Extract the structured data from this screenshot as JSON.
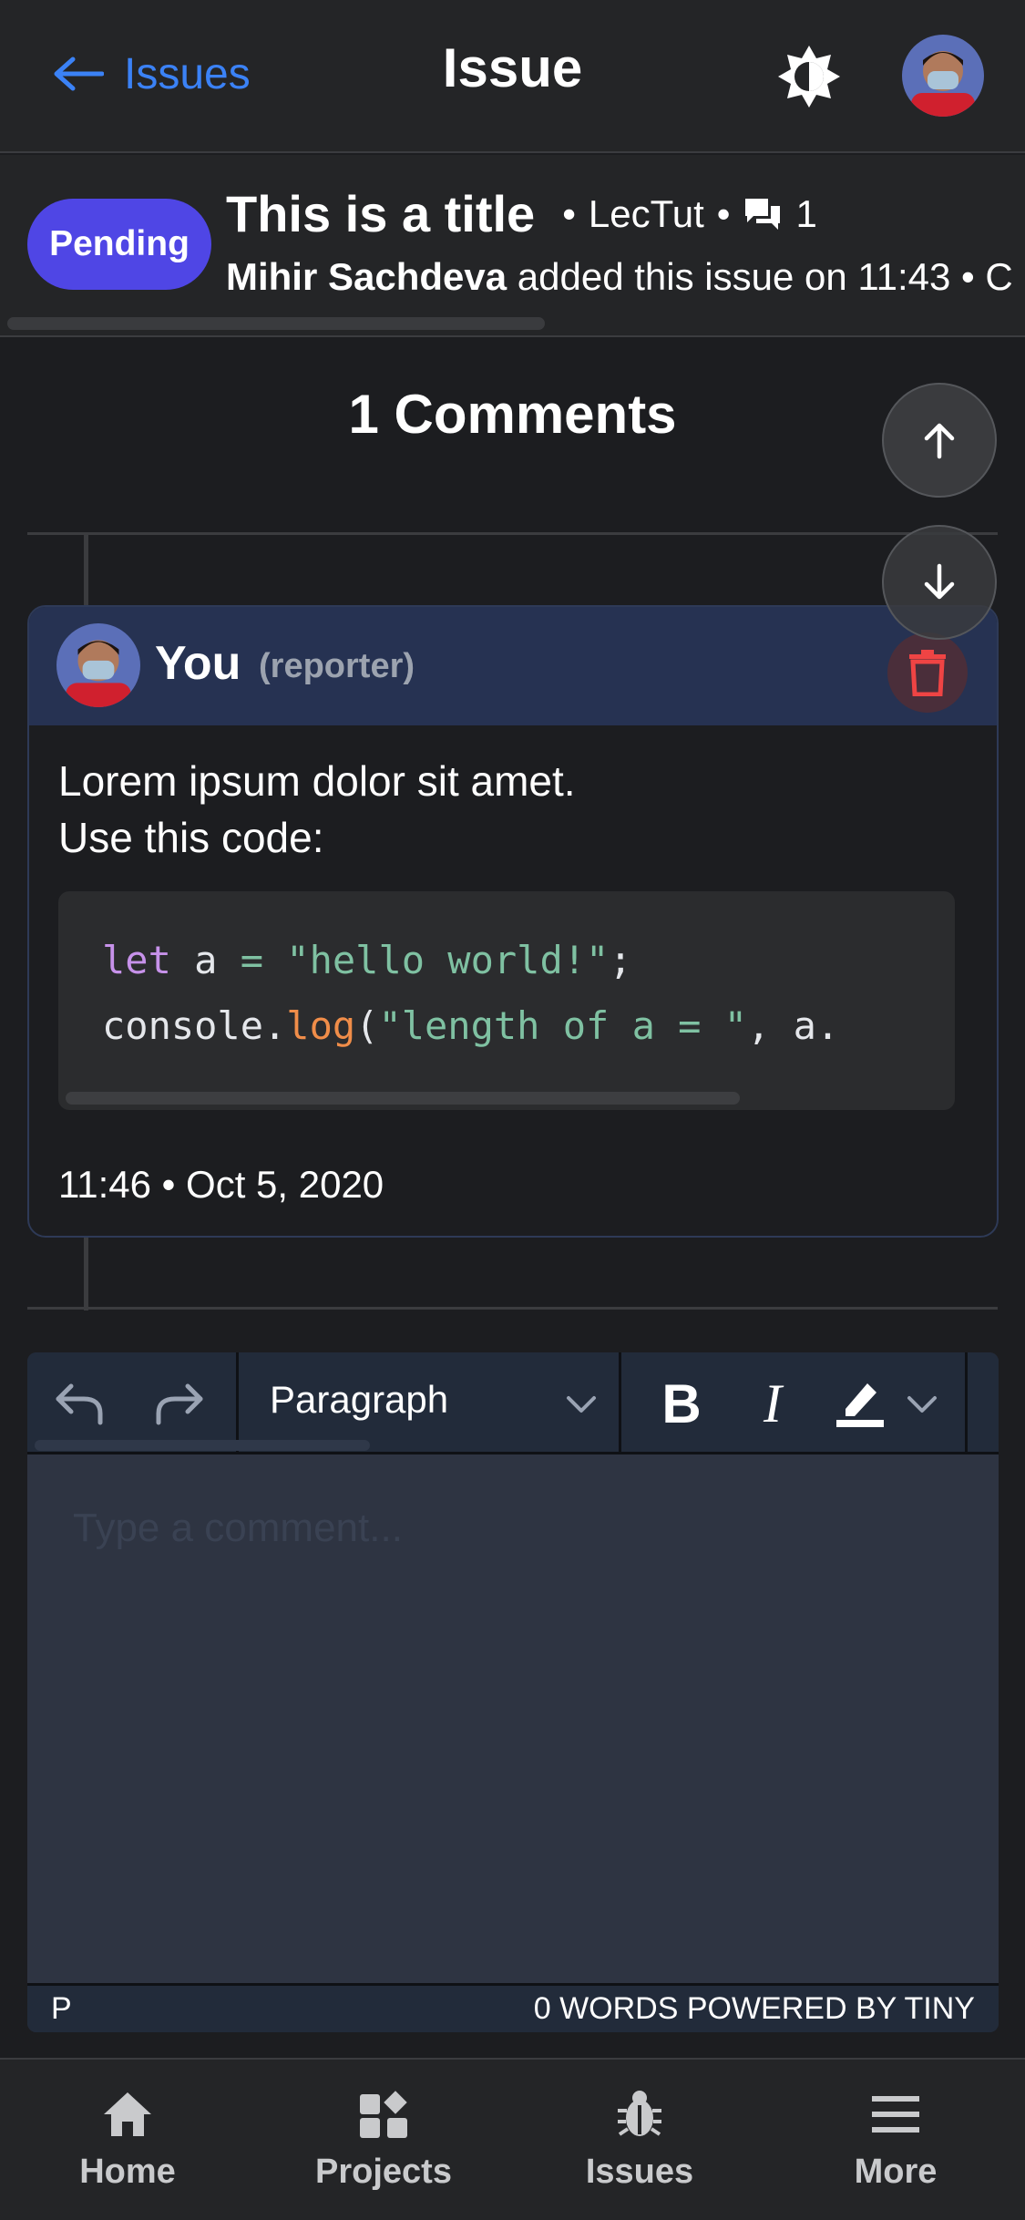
{
  "header": {
    "back_label": "Issues",
    "title": "Issue"
  },
  "issue": {
    "status": "Pending",
    "title": "This is a title",
    "project": "LecTut",
    "comment_count": "1",
    "author": "Mihir Sachdeva",
    "meta": "added this issue on 11:43 • C"
  },
  "comments": {
    "heading": "1 Comments",
    "items": [
      {
        "author": "You",
        "role": "(reporter)",
        "body_line1": "Lorem ipsum dolor sit amet.",
        "body_line2": "Use this code:",
        "time": "11:46 • Oct 5, 2020",
        "code": {
          "l1_kw": "let",
          "l1_var": " a ",
          "l1_op": "=",
          "l1_str": " \"hello world!\"",
          "l1_end": ";",
          "l2_obj": "console.",
          "l2_fn": "log",
          "l2_paren": "(",
          "l2_str": "\"length of a = \"",
          "l2_rest": ", a."
        }
      }
    ]
  },
  "editor": {
    "format_label": "Paragraph",
    "placeholder": "Type a comment...",
    "status_left": "P",
    "status_right": "0 WORDS  POWERED BY TINY"
  },
  "bottom_nav": {
    "items": [
      {
        "label": "Home",
        "icon": "home-icon"
      },
      {
        "label": "Projects",
        "icon": "projects-icon"
      },
      {
        "label": "Issues",
        "icon": "bug-icon"
      },
      {
        "label": "More",
        "icon": "menu-icon"
      }
    ]
  },
  "colors": {
    "accent": "#3b82f6",
    "pending_badge": "#4f46e5",
    "delete_red": "#ef4444",
    "background": "#1c1d20"
  }
}
